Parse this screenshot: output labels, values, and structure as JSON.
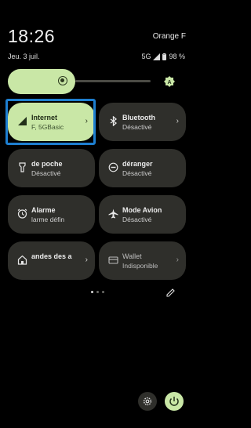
{
  "status_bar": {
    "time": "18:26",
    "carrier": "Orange F",
    "date": "Jeu. 3 juil.",
    "network": "5G",
    "battery": "98 %"
  },
  "brightness": {
    "level": 0.4
  },
  "tiles": [
    {
      "title": "Internet",
      "subtitle": "F, 5GBasic",
      "icon": "signal-icon",
      "active": true
    },
    {
      "title": "Bluetooth",
      "subtitle": "Désactivé",
      "icon": "bluetooth-icon",
      "active": false
    },
    {
      "title": "de poche",
      "subtitle": "Désactivé",
      "icon": "flashlight-icon",
      "active": false
    },
    {
      "title": "déranger",
      "subtitle": "Désactivé",
      "icon": "do-not-disturb-icon",
      "active": false
    },
    {
      "title": "Alarme",
      "subtitle": "larme défin",
      "icon": "alarm-icon",
      "active": false
    },
    {
      "title": "Mode Avion",
      "subtitle": "Désactivé",
      "icon": "airplane-icon",
      "active": false
    },
    {
      "title": "andes des a",
      "subtitle": "",
      "icon": "home-icon",
      "active": false
    },
    {
      "title": "Wallet",
      "subtitle": "Indisponible",
      "icon": "wallet-icon",
      "active": false
    }
  ],
  "pager": {
    "pages": 3,
    "current": 1
  },
  "colors": {
    "accent": "#c9e7a6",
    "tile_bg": "#2f2f2b",
    "focus": "#1e7fd0"
  }
}
